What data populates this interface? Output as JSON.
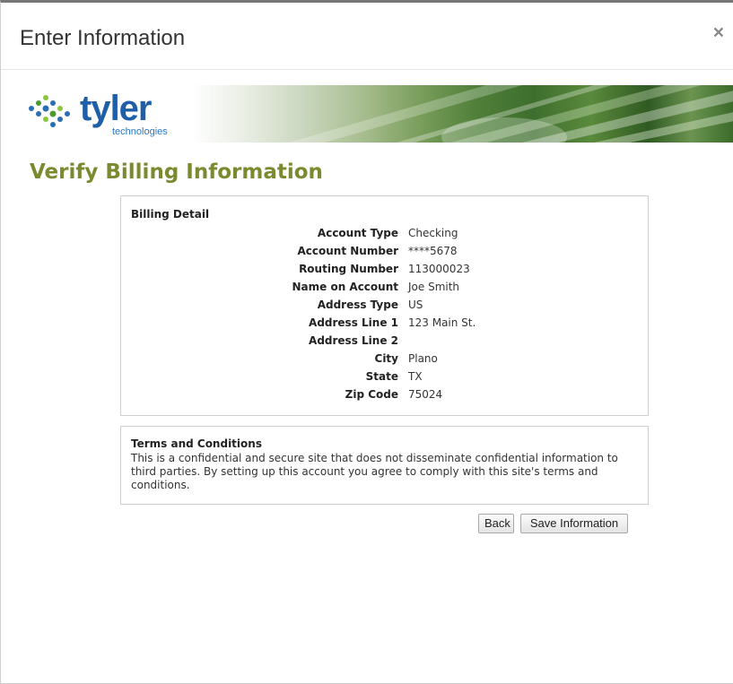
{
  "dialog": {
    "title": "Enter Information",
    "close_glyph": "×"
  },
  "banner": {
    "logo_word": "tyler",
    "logo_sub": "technologies",
    "logo_icon": "tyler-dots-icon",
    "brand_color": "#1f5fa8"
  },
  "page": {
    "heading": "Verify Billing Information",
    "heading_color": "#7b8a2e"
  },
  "billing": {
    "title": "Billing Detail",
    "rows": [
      {
        "label": "Account Type",
        "value": "Checking"
      },
      {
        "label": "Account Number",
        "value": "****5678"
      },
      {
        "label": "Routing Number",
        "value": "113000023"
      },
      {
        "label": "Name on Account",
        "value": "Joe Smith"
      },
      {
        "label": "Address Type",
        "value": "US"
      },
      {
        "label": "Address Line 1",
        "value": "123 Main St."
      },
      {
        "label": "Address Line 2",
        "value": ""
      },
      {
        "label": "City",
        "value": "Plano"
      },
      {
        "label": "State",
        "value": "TX"
      },
      {
        "label": "Zip Code",
        "value": "75024"
      }
    ]
  },
  "terms": {
    "title": "Terms and Conditions",
    "text": "This is a confidential and secure site that does not disseminate confidential information to third parties. By setting up this account you agree to comply with this site's terms and conditions."
  },
  "actions": {
    "back_label": "Back",
    "save_label": "Save Information"
  }
}
